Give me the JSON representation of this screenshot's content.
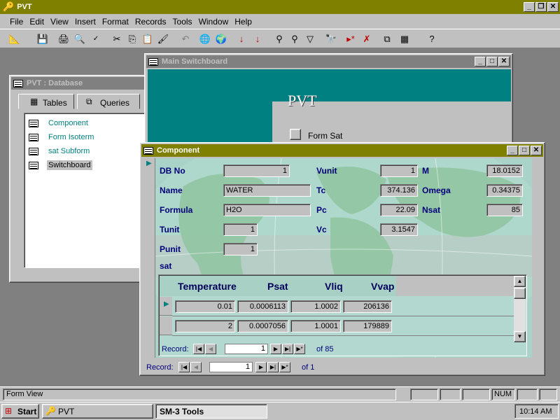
{
  "app": {
    "title": "PVT"
  },
  "menu": [
    "File",
    "Edit",
    "View",
    "Insert",
    "Format",
    "Records",
    "Tools",
    "Window",
    "Help"
  ],
  "toolbar": [
    "design-view",
    "save",
    "print",
    "print-preview",
    "spelling",
    "cut",
    "copy",
    "paste",
    "format-painter",
    "undo",
    "insert-hyperlink",
    "web-toolbar",
    "sort-ascending",
    "sort-descending",
    "filter-by-selection",
    "filter-by-form",
    "apply-filter",
    "find",
    "new-record",
    "delete-record",
    "properties",
    "database-window",
    "new-object",
    "help"
  ],
  "db_window": {
    "title": "PVT : Database",
    "tabs": [
      "Tables",
      "Queries"
    ],
    "items": [
      "Component",
      "Form Isoterm",
      "sat Subform",
      "Switchboard"
    ]
  },
  "switchboard": {
    "title": "Main Switchboard",
    "heading": "PVT",
    "option": "Form Sat"
  },
  "component": {
    "title": "Component",
    "labels": {
      "db_no": "DB No",
      "name": "Name",
      "formula": "Formula",
      "tunit": "Tunit",
      "punit": "Punit",
      "vunit": "Vunit",
      "tc": "Tc",
      "pc": "Pc",
      "vc": "Vc",
      "m": "M",
      "omega": "Omega",
      "nsat": "Nsat",
      "sat": "sat"
    },
    "values": {
      "db_no": "1",
      "name": "WATER",
      "formula": "H2O",
      "tunit": "1",
      "punit": "1",
      "vunit": "1",
      "tc": "374.136",
      "pc": "22.09",
      "vc": "3.1547",
      "m": "18.0152",
      "omega": "0.34375",
      "nsat": "85"
    },
    "subform": {
      "columns": [
        "Temperature",
        "Psat",
        "Vliq",
        "Vvap"
      ],
      "rows": [
        [
          "0.01",
          "0.0006113",
          "1.0002",
          "206136"
        ],
        [
          "2",
          "0.0007056",
          "1.0001",
          "179889"
        ]
      ],
      "record_label": "Record:",
      "record_value": "1",
      "record_of": "of 85"
    },
    "record_label": "Record:",
    "record_value": "1",
    "record_of": "of 1"
  },
  "status": {
    "text": "Form View",
    "num": "NUM"
  },
  "taskbar": {
    "start": "Start",
    "tasks": [
      "PVT",
      "SM-3 Tools"
    ],
    "clock": "10:14 AM"
  },
  "colors": {
    "titlebar_active": "#808000",
    "teal": "#008080",
    "label": "#00007b"
  }
}
